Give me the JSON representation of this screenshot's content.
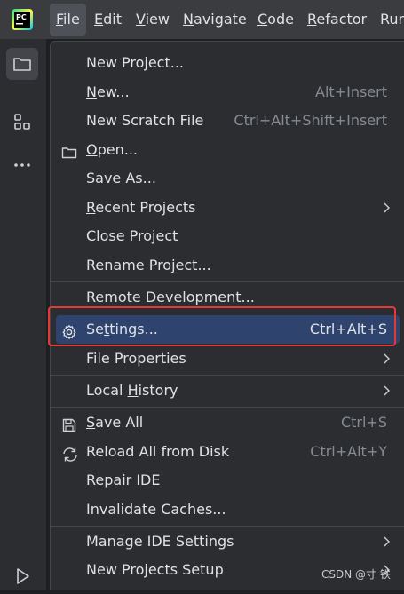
{
  "menubar": {
    "items": [
      {
        "mnemonic": "F",
        "rest": "ile"
      },
      {
        "mnemonic": "E",
        "rest": "dit"
      },
      {
        "mnemonic": "V",
        "rest": "iew"
      },
      {
        "mnemonic": "N",
        "rest": "avigate"
      },
      {
        "mnemonic": "C",
        "rest": "ode"
      },
      {
        "mnemonic": "R",
        "rest": "efactor"
      },
      {
        "mnemonic": "",
        "rest": "Run"
      }
    ]
  },
  "logo": {
    "text": "PC",
    "icon": "pycharm-logo"
  },
  "file_menu": {
    "new_project": "New Project...",
    "new_pre": "",
    "new_mn": "N",
    "new_post": "ew...",
    "new_shortcut": "Alt+Insert",
    "new_scratch": "New Scratch File",
    "new_scratch_shortcut": "Ctrl+Alt+Shift+Insert",
    "open_mn": "O",
    "open_post": "pen...",
    "save_as": "Save As...",
    "recent_mn": "R",
    "recent_post": "ecent Projects",
    "close_project": "Close Project",
    "rename_project": "Rename Project...",
    "remote_dev": "Remote Development...",
    "settings_pre": "Se",
    "settings_mn": "t",
    "settings_post": "tings...",
    "settings_shortcut": "Ctrl+Alt+S",
    "file_properties": "File Properties",
    "local_history_pre": "Local ",
    "local_history_mn": "H",
    "local_history_post": "istory",
    "save_all_mn": "S",
    "save_all_post": "ave All",
    "save_all_shortcut": "Ctrl+S",
    "reload": "Reload All from Disk",
    "reload_shortcut": "Ctrl+Alt+Y",
    "repair_ide": "Repair IDE",
    "invalidate_caches": "Invalidate Caches...",
    "manage_ide_settings": "Manage IDE Settings",
    "new_projects_setup": "New Projects Setup"
  },
  "watermark": "CSDN @寸 铁",
  "colors": {
    "highlight": "#2e436e",
    "annotation": "#e53935"
  }
}
